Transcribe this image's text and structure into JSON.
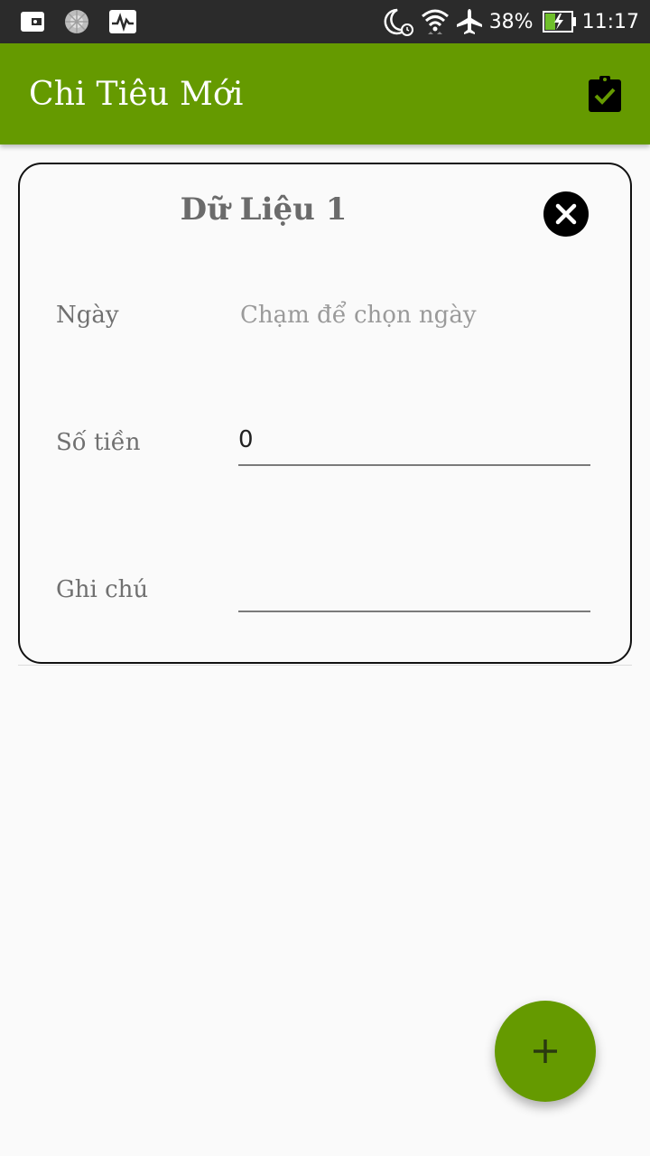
{
  "status_bar": {
    "battery": "38%",
    "time": "11:17",
    "icons": [
      "wallet-icon",
      "loading-icon",
      "activity-icon",
      "moon-alarm-icon",
      "wifi-icon",
      "airplane-icon",
      "battery-charging-icon"
    ]
  },
  "app_bar": {
    "title": "Chi Tiêu Mới",
    "save_icon": "clipboard-check-icon"
  },
  "card": {
    "title": "Dữ Liệu 1",
    "close_icon": "close-icon",
    "date_label": "Ngày",
    "date_placeholder": "Chạm để chọn ngày",
    "amount_label": "Số tiền",
    "amount_value": "0",
    "note_label": "Ghi chú",
    "note_value": ""
  },
  "fab": {
    "icon": "plus-icon"
  },
  "colors": {
    "primary": "#659a00",
    "status_bar": "#2b2b2b",
    "background": "#fafafa"
  }
}
